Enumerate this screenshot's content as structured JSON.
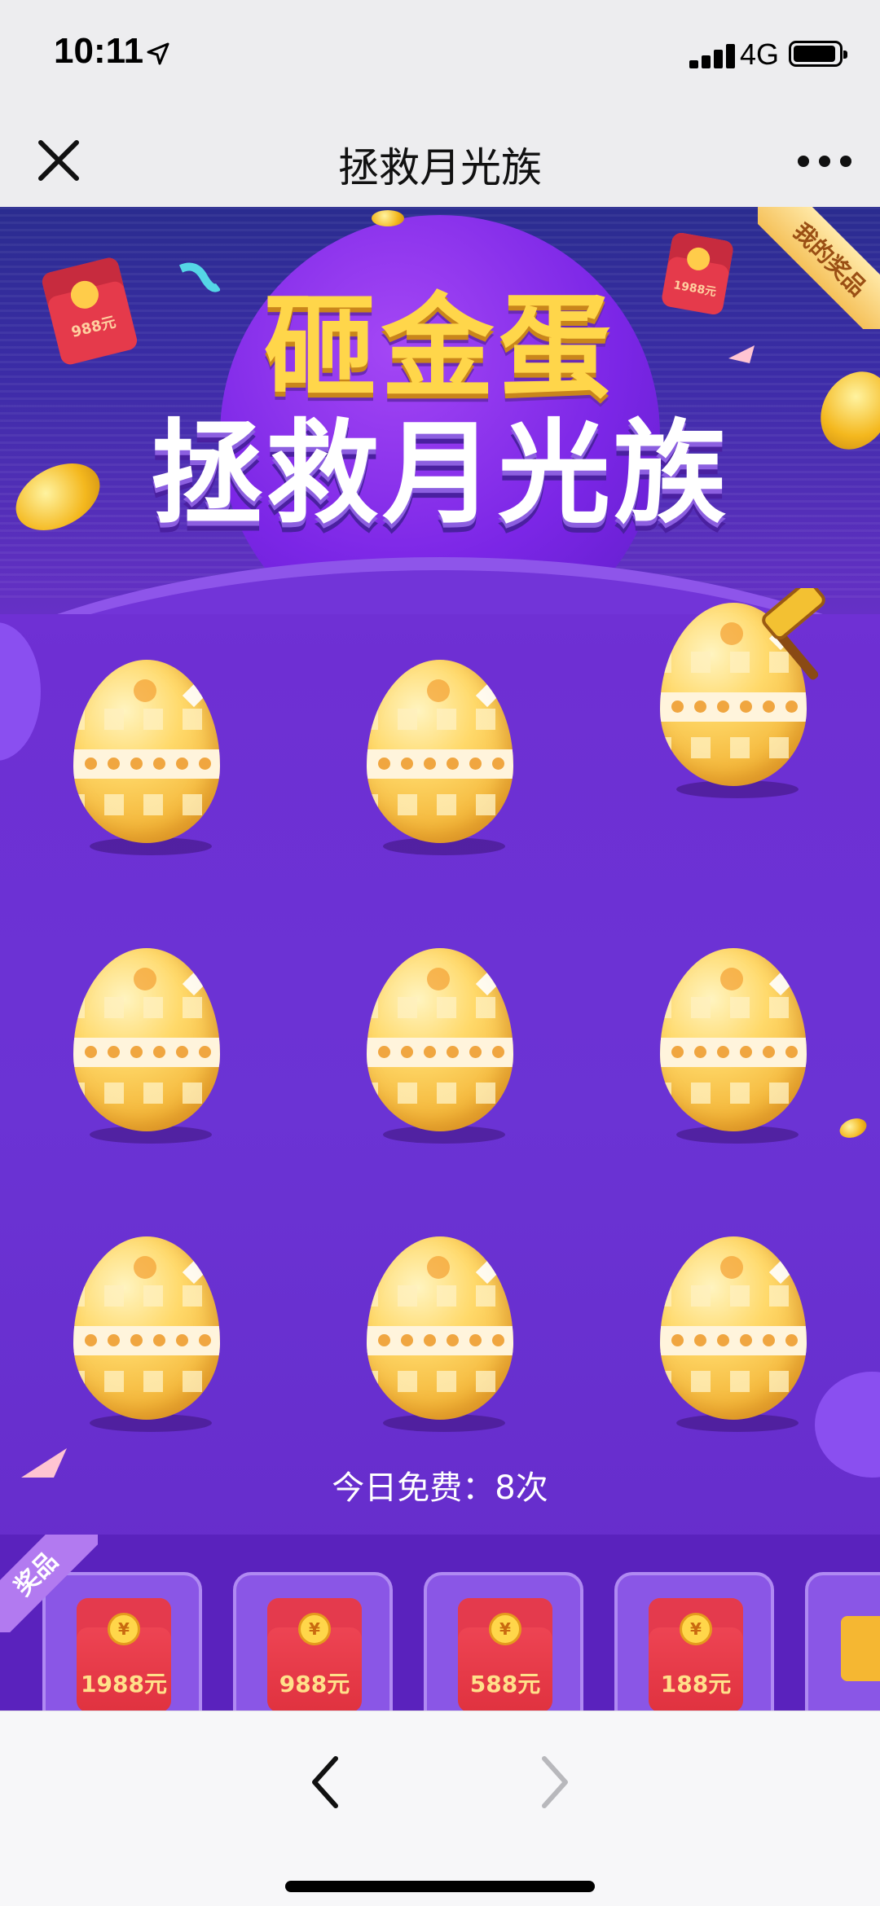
{
  "status_bar": {
    "time": "10:11",
    "network": "4G"
  },
  "nav": {
    "title": "拯救月光族"
  },
  "banner": {
    "line1": "砸金蛋",
    "line2": "拯救月光族",
    "my_prizes": "我的奖品",
    "deco_envelope_1": "988元",
    "deco_envelope_2": "1988元"
  },
  "game": {
    "free_today": "今日免费：8次",
    "egg_count": 9
  },
  "prizes": {
    "tag": "奖品",
    "items": [
      {
        "label": "1988元",
        "icon": "red-envelope-icon"
      },
      {
        "label": "988元",
        "icon": "red-envelope-icon"
      },
      {
        "label": "588元",
        "icon": "red-envelope-icon"
      },
      {
        "label": "188元",
        "icon": "red-envelope-icon"
      },
      {
        "label": "",
        "icon": "gift-box-icon"
      }
    ],
    "coin_symbol": "¥"
  },
  "colors": {
    "purple_bg": "#6e2fd3",
    "gold": "#ffd64a",
    "red_envelope": "#e0323f"
  }
}
